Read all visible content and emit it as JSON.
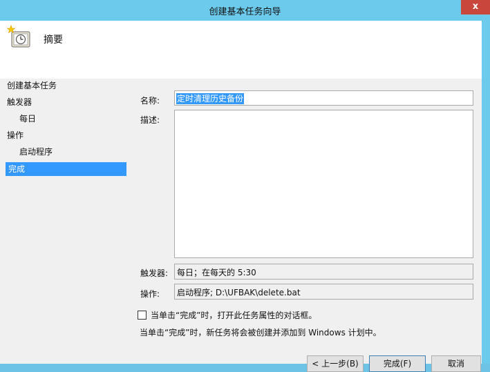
{
  "window": {
    "title": "创建基本任务向导",
    "close_label": "x"
  },
  "header": {
    "title": "摘要"
  },
  "nav": {
    "items": [
      {
        "label": "创建基本任务"
      },
      {
        "label": "触发器"
      },
      {
        "label": "每日"
      },
      {
        "label": "操作"
      },
      {
        "label": "启动程序"
      },
      {
        "label": "完成"
      }
    ],
    "selected": "完成"
  },
  "form": {
    "name_label": "名称:",
    "name_value": "定时清理历史备份",
    "desc_label": "描述:",
    "desc_value": "",
    "trigger_label": "触发器:",
    "trigger_value": "每日；在每天的 5:30",
    "action_label": "操作:",
    "action_value": "启动程序; D:\\UFBAK\\delete.bat"
  },
  "options": {
    "open_props_label": "当单击“完成”时，打开此任务属性的对话框。",
    "open_props_checked": false,
    "note": "当单击“完成”时，新任务将会被创建并添加到 Windows 计划中。"
  },
  "buttons": {
    "back": "< 上一步(B)",
    "finish": "完成(F)",
    "cancel": "取消"
  }
}
